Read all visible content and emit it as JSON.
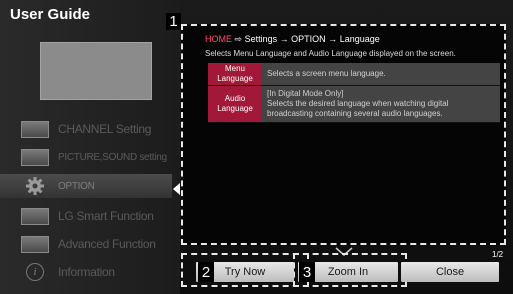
{
  "app": {
    "title": "User Guide"
  },
  "sidebar": {
    "items": [
      {
        "label": "CHANNEL Setting",
        "icon": "tv-channel-icon"
      },
      {
        "label": "PICTURE,SOUND setting",
        "icon": "picture-sound-icon"
      },
      {
        "label": "OPTION",
        "icon": "gear-icon",
        "active": true
      },
      {
        "label": "LG Smart Function",
        "icon": "smart-tv-icon"
      },
      {
        "label": "Advanced Function",
        "icon": "advanced-device-icon"
      },
      {
        "label": "Information",
        "icon": "info-icon"
      }
    ]
  },
  "markers": {
    "m1": "1",
    "m2": "2",
    "m3": "3"
  },
  "content": {
    "breadcrumb": {
      "home": "HOME",
      "arrow": "⇨",
      "settings": "Settings",
      "arrow2": "→",
      "option": "OPTION",
      "arrow3": "→",
      "language": "Language"
    },
    "description": "Selects Menu Language and Audio Language displayed on the screen.",
    "table": [
      {
        "head": "Menu Language",
        "body": "Selects a screen menu language."
      },
      {
        "head": "Audio Language",
        "body_line1": "[In Digital Mode Only]",
        "body_line2": "Selects the desired language when watching digital broadcasting containing several audio languages."
      }
    ],
    "page_indicator": "1/2"
  },
  "buttons": {
    "try_now": "Try Now",
    "zoom_in": "Zoom In",
    "close": "Close"
  },
  "colors": {
    "accent": "#a11838",
    "breadcrumb_home": "#ff4d6a"
  }
}
